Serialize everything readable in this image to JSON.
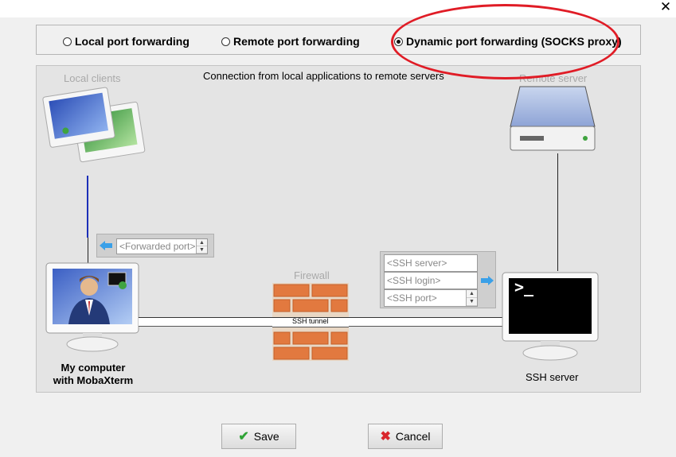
{
  "window": {
    "close_glyph": "✕"
  },
  "modes": [
    {
      "label": "Local port forwarding",
      "selected": false
    },
    {
      "label": "Remote port forwarding",
      "selected": false
    },
    {
      "label": "Dynamic port forwarding (SOCKS proxy)",
      "selected": true
    }
  ],
  "diagram": {
    "title": "Connection from local applications to remote servers",
    "local_clients_label": "Local clients",
    "remote_server_label": "Remote server",
    "firewall_label": "Firewall",
    "tunnel_label": "SSH tunnel",
    "my_computer_line1": "My computer",
    "my_computer_line2": "with MobaXterm",
    "ssh_server_label": "SSH server",
    "forwarded_port_placeholder": "<Forwarded port>",
    "ssh_server_placeholder": "<SSH server>",
    "ssh_login_placeholder": "<SSH login>",
    "ssh_port_placeholder": "<SSH port>",
    "terminal_prompt": ">_"
  },
  "buttons": {
    "save_label": "Save",
    "cancel_label": "Cancel"
  },
  "colors": {
    "highlight": "#e01c26",
    "local_link": "#1c2fb8",
    "arrow": "#3aa0e8"
  }
}
